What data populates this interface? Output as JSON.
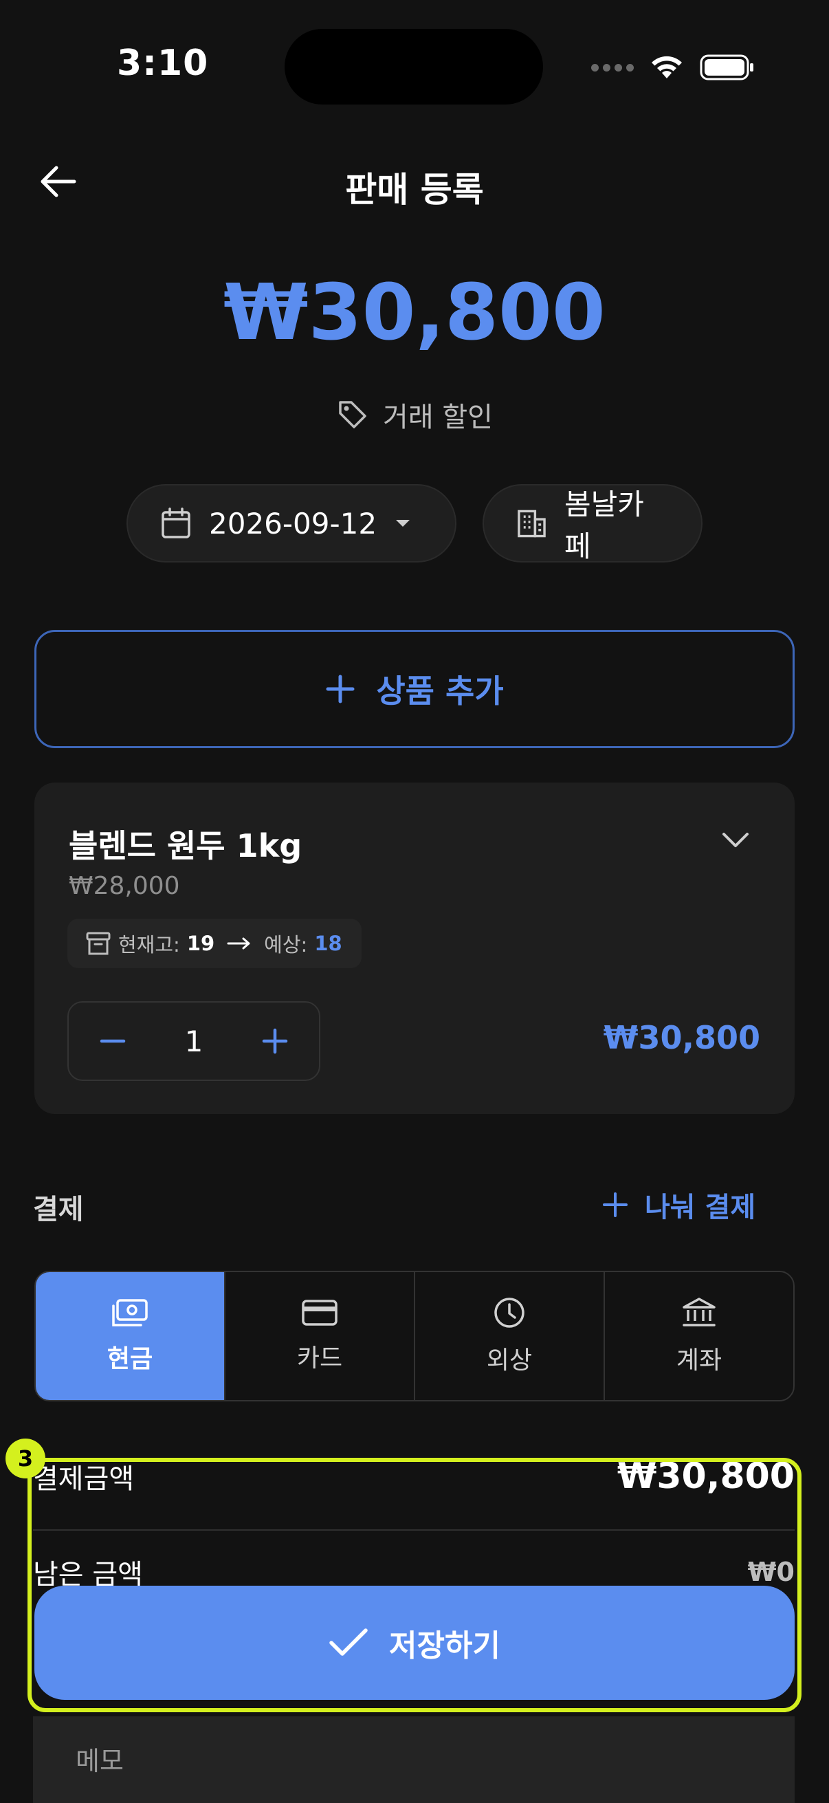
{
  "status_bar": {
    "time": "3:10"
  },
  "header": {
    "title": "판매 등록"
  },
  "total": {
    "amount": "₩30,800"
  },
  "discount": {
    "label": "거래 할인"
  },
  "filters": {
    "date": "2026-09-12",
    "store": "봄날카페"
  },
  "add_product": {
    "label": "상품 추가"
  },
  "product": {
    "name": "블렌드 원두 1kg",
    "price": "₩28,000",
    "stock_label": "현재고:",
    "stock_value": "19",
    "expected_label": "예상:",
    "expected_value": "18",
    "quantity": "1",
    "line_total": "₩30,800"
  },
  "payment": {
    "section_label": "결제",
    "split_label": "나눠 결제",
    "methods": [
      {
        "label": "현금",
        "icon": "cash-icon",
        "active": true
      },
      {
        "label": "카드",
        "icon": "card-icon",
        "active": false
      },
      {
        "label": "외상",
        "icon": "clock-icon",
        "active": false
      },
      {
        "label": "계좌",
        "icon": "bank-icon",
        "active": false
      }
    ],
    "amount_label": "결제금액",
    "amount_value": "₩30,800",
    "remaining_label": "남은 금액",
    "remaining_value": "₩0"
  },
  "save": {
    "label": "저장하기"
  },
  "memo": {
    "label": "메모"
  },
  "annotation": {
    "badge": "3"
  },
  "colors": {
    "accent": "#5b8def",
    "highlight": "#d4f01e",
    "background": "#121212"
  }
}
